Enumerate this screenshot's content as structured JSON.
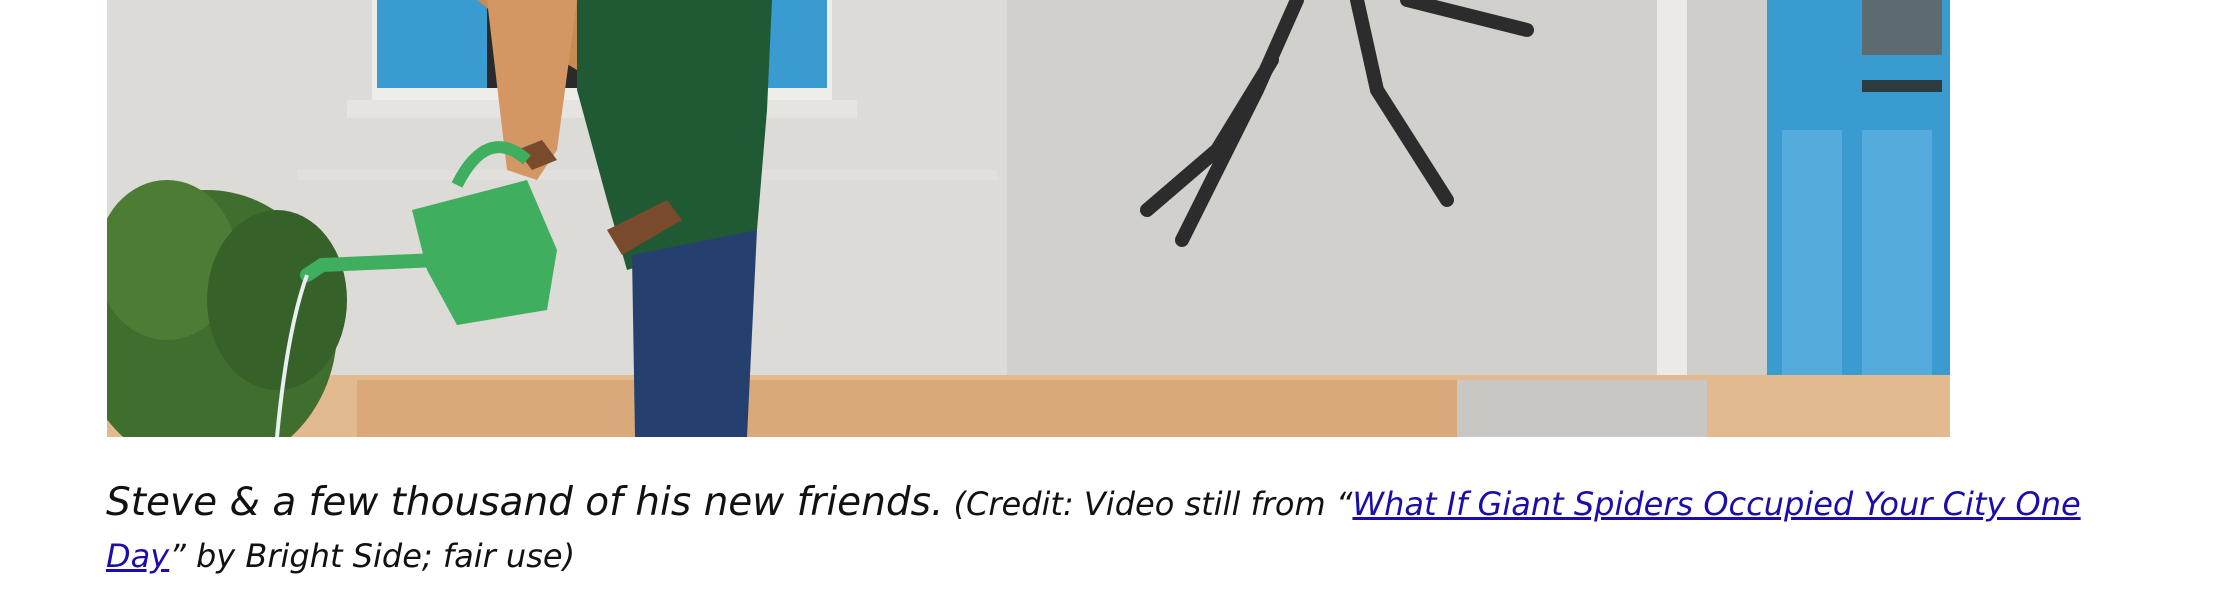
{
  "figure": {
    "image_alt": "Man watering a plant next to a giant spider on a white wall",
    "caption": {
      "main": "Steve & a few thousand of his new friends.",
      "credit_prefix": " (Credit: Video still from “",
      "link_text": "What If Giant Spiders Occupied Your City One Day",
      "credit_suffix": "” by Bright Side; fair use)"
    }
  },
  "colors": {
    "wall": "#dedcd8",
    "shutter_blue": "#3a9bd0",
    "watering_can": "#3fae5e",
    "apron": "#1f5a34",
    "jeans": "#25406e",
    "link": "#1a0dab"
  }
}
